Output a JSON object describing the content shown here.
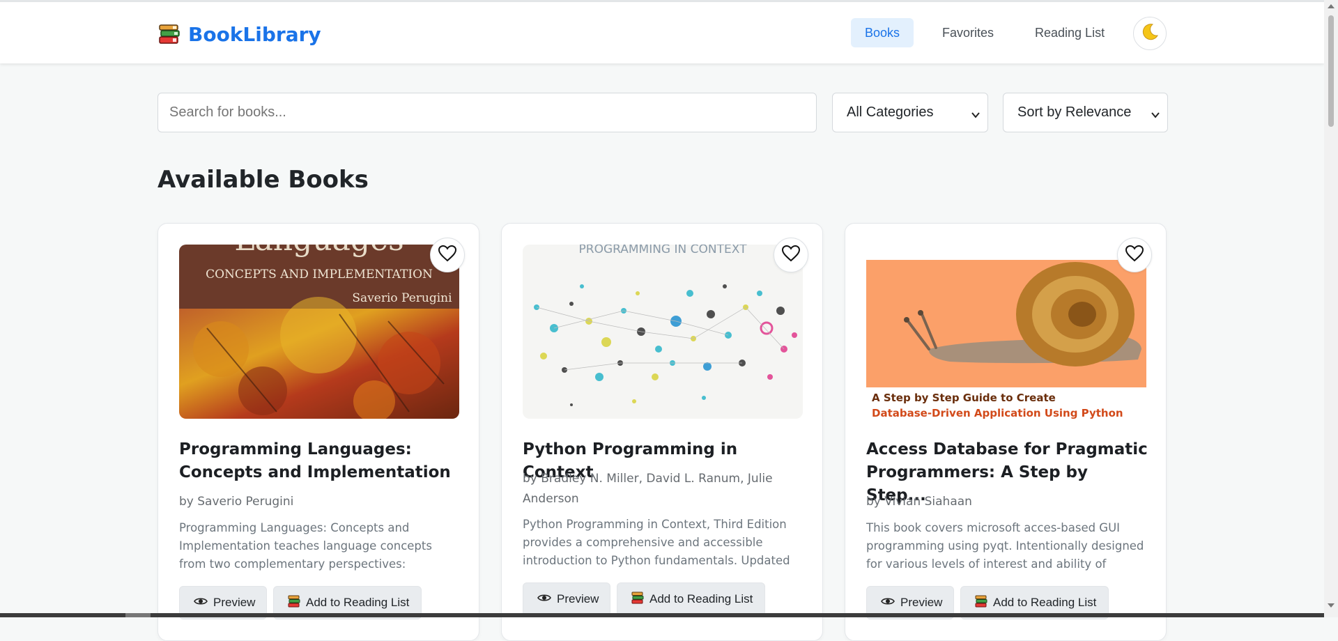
{
  "app": {
    "brand": "BookLibrary",
    "brand_icon": "books-stack-icon",
    "accent_color": "#1a73e8"
  },
  "nav": {
    "items": [
      {
        "label": "Books",
        "active": true
      },
      {
        "label": "Favorites",
        "active": false
      },
      {
        "label": "Reading List",
        "active": false
      }
    ],
    "theme_toggle_icon": "moon-icon"
  },
  "controls": {
    "search_placeholder": "Search for books...",
    "search_value": "",
    "category_selected": "All Categories",
    "sort_selected": "Sort by Relevance"
  },
  "section": {
    "title": "Available Books"
  },
  "books": [
    {
      "title": "Programming Languages: Concepts and Implementation",
      "author": "by Saverio Perugini",
      "description": "Programming Languages: Concepts and Implementation teaches language concepts from two complementary perspectives: implementation and...",
      "cover_text": [
        "Languages",
        "CONCEPTS AND IMPLEMENTATION",
        "Saverio Perugini"
      ],
      "preview_label": "Preview",
      "reading_list_label": "Add to Reading List",
      "favorite_icon": "heart-outline-icon"
    },
    {
      "title": "Python Programming in Context",
      "author": "by Bradley N. Miller, David L. Ranum, Julie Anderson",
      "description": "Python Programming in Context, Third Edition provides a comprehensive and accessible introduction to Python fundamentals. Updated with...",
      "cover_text": [
        "PROGRAMMING IN CONTEXT"
      ],
      "preview_label": "Preview",
      "reading_list_label": "Add to Reading List",
      "favorite_icon": "heart-outline-icon"
    },
    {
      "title": "Access Database for Pragmatic Programmers: A Step by Step...",
      "author": "by Vivian Siahaan",
      "description": "This book covers microsoft acces-based GUI programming using pyqt. Intentionally designed for various levels of interest and ability of learners, this...",
      "cover_text": [
        "A Step by Step Guide to Create",
        "Database-Driven Application Using Python"
      ],
      "preview_label": "Preview",
      "reading_list_label": "Add to Reading List",
      "favorite_icon": "heart-outline-icon"
    }
  ]
}
